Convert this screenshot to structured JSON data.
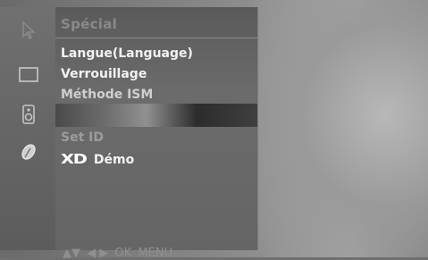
{
  "menu": {
    "title": "Spécial",
    "items": [
      {
        "label": "Langue(Language)"
      },
      {
        "label": "Verrouillage"
      },
      {
        "label": "Méthode ISM"
      },
      {
        "label": ""
      },
      {
        "label": "Set ID"
      },
      {
        "logo": "XD",
        "label": "Démo"
      }
    ]
  },
  "footer": {
    "arrows_updown": "▲▼",
    "arrows_leftright": "◀ ▶",
    "ok": "OK",
    "menu": "MENU"
  },
  "icons": [
    "cursor-icon",
    "screen-icon",
    "speaker-icon",
    "satellite-dish-icon"
  ]
}
